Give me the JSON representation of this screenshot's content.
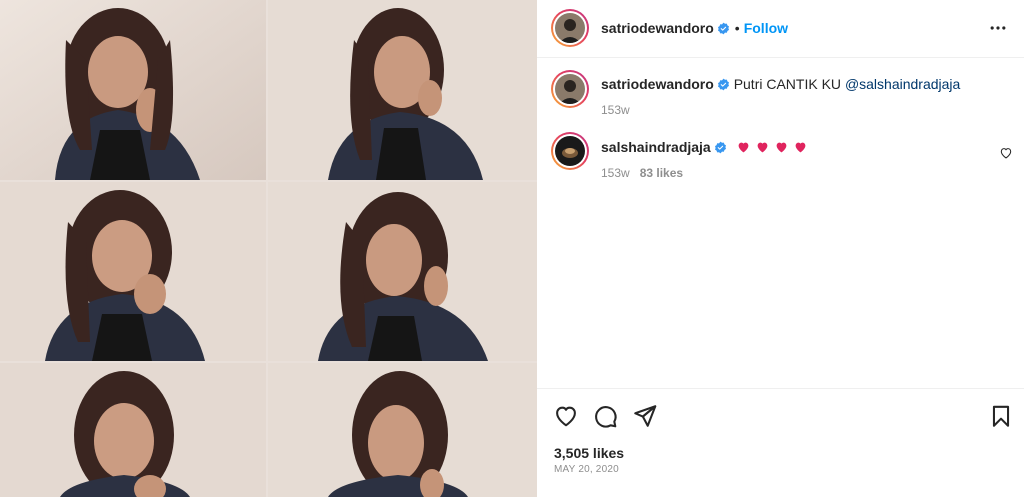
{
  "post": {
    "author": "satriodewandoro",
    "follow_label": "Follow",
    "separator": "•"
  },
  "caption": {
    "author": "satriodewandoro",
    "text": "Putri CANTIK KU",
    "mention": "@salshaindradjaja",
    "time": "153w"
  },
  "comments": [
    {
      "author": "salshaindradjaja",
      "emoji": "heart-emoji ×4",
      "time": "153w",
      "likes": "83 likes"
    }
  ],
  "footer": {
    "likes": "3,505 likes",
    "date": "MAY 20, 2020"
  },
  "icons": {
    "like": "heart-outline-icon",
    "comment": "comment-bubble-icon",
    "share": "paper-plane-icon",
    "save": "bookmark-icon",
    "more": "more-horizontal-icon",
    "verified": "verified-badge-icon"
  },
  "colors": {
    "accent": "#0095f6",
    "verified": "#3897f0",
    "mention": "#00376b",
    "heart": "#ed4956",
    "muted": "#8e8e8e"
  }
}
